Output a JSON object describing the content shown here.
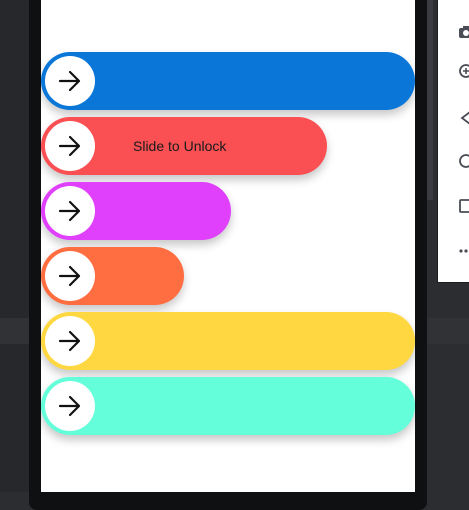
{
  "sliders": [
    {
      "label": "",
      "color": "#0a76d8",
      "progress": 1.0
    },
    {
      "label": "Slide to Unlock",
      "color": "#fa5054",
      "progress": 0.76
    },
    {
      "label": "",
      "color": "#e040fb",
      "progress": 0.51
    },
    {
      "label": "",
      "color": "#ff6e40",
      "progress": 0.38
    },
    {
      "label": "",
      "color": "#ffd740",
      "progress": 1.0
    },
    {
      "label": "",
      "color": "#64ffda",
      "progress": 1.0
    }
  ],
  "icons": {
    "knob": "arrow-right-icon",
    "toolbar": [
      "camera-icon",
      "zoom-in-icon",
      "back-icon",
      "home-icon",
      "overview-icon",
      "more-icon"
    ]
  }
}
